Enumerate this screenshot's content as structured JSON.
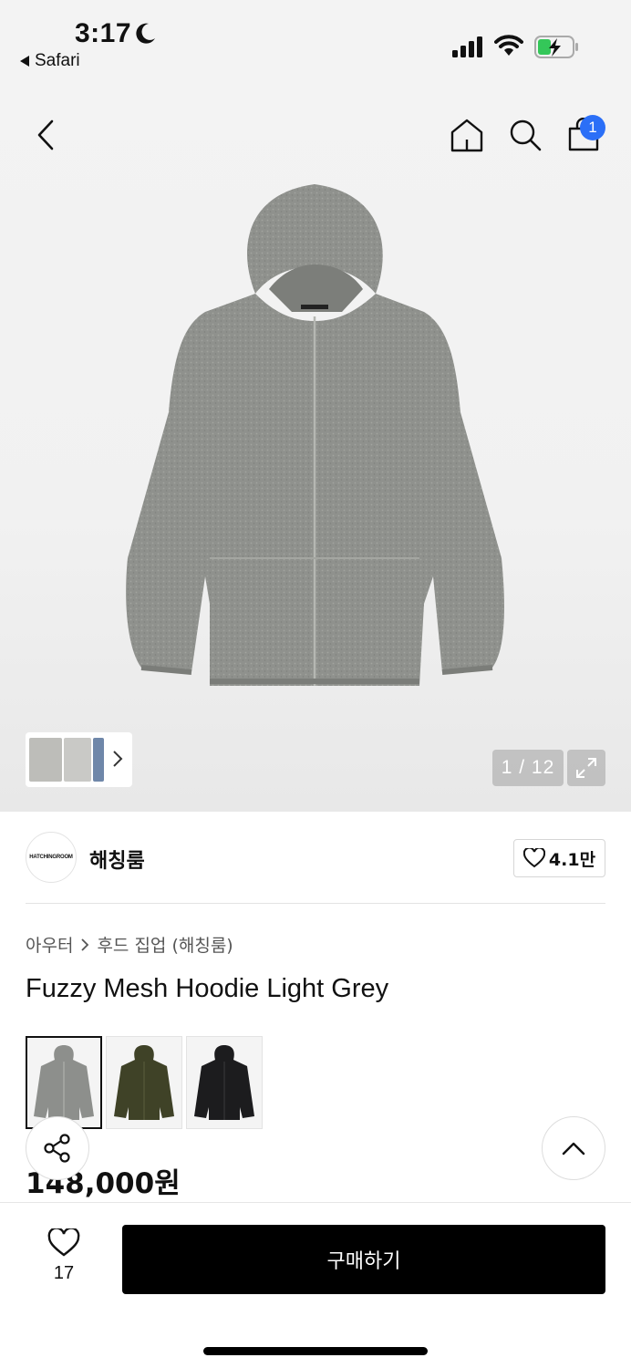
{
  "status": {
    "time": "3:17",
    "back_app": "Safari"
  },
  "header": {
    "cart_count": "1",
    "icons": [
      "back-icon",
      "home-icon",
      "search-icon",
      "cart-icon"
    ]
  },
  "gallery": {
    "counter": "1 / 12"
  },
  "brand": {
    "logo_text": "HATCHINGROOM",
    "name": "해칭룸",
    "likes": "4.1만"
  },
  "product": {
    "breadcrumb": [
      "아우터",
      "후드 집업 (해칭룸)"
    ],
    "title": "Fuzzy Mesh Hoodie Light Grey",
    "price": "148,000원",
    "colors": [
      {
        "name": "light-grey",
        "color": "#8d8f8c"
      },
      {
        "name": "olive",
        "color": "#3f4227"
      },
      {
        "name": "black",
        "color": "#1c1c1e"
      }
    ]
  },
  "bottom": {
    "wish_count": "17",
    "buy_label": "구매하기"
  },
  "colors": {
    "badge": "#2b6ff7",
    "buy_button": "#000000"
  }
}
